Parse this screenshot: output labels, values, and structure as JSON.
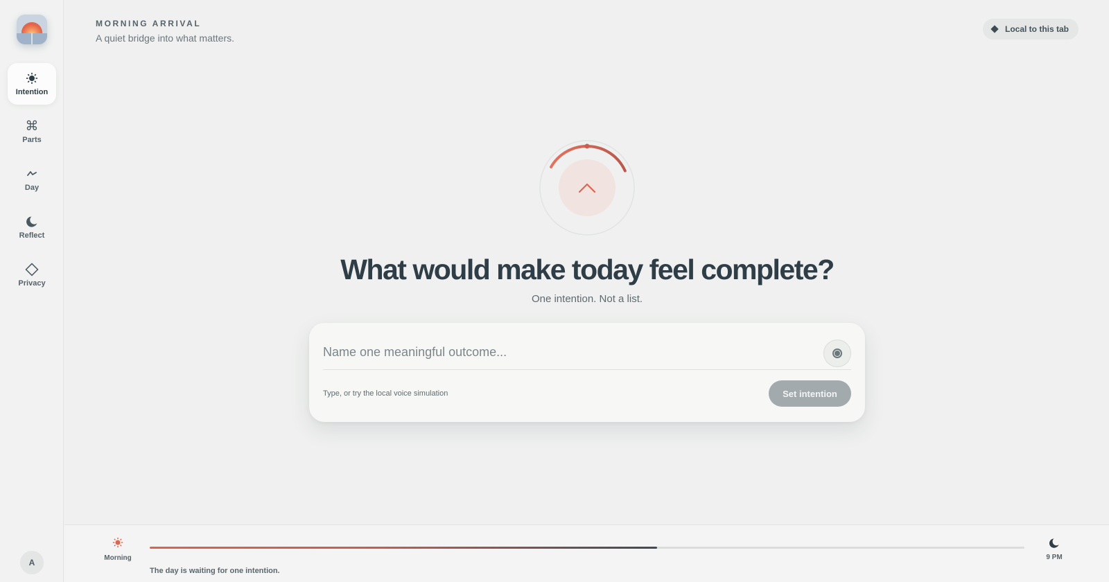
{
  "app": {
    "eyebrow": "MORNING ARRIVAL",
    "tagline": "A quiet bridge into what matters.",
    "privacy_badge": "Local to this tab"
  },
  "sidebar": {
    "items": [
      {
        "label": "Intention",
        "icon": "sun-icon",
        "active": true
      },
      {
        "label": "Parts",
        "icon": "command-icon",
        "active": false
      },
      {
        "label": "Day",
        "icon": "lightning-icon",
        "active": false
      },
      {
        "label": "Reflect",
        "icon": "moon-icon",
        "active": false
      },
      {
        "label": "Privacy",
        "icon": "diamond-icon",
        "active": false
      }
    ],
    "avatar_initial": "A"
  },
  "main": {
    "question": "What would make today feel complete?",
    "subtitle": "One intention. Not a list.",
    "dial_progress": 0.35,
    "input_placeholder": "Name one meaningful outcome...",
    "input_value": "",
    "hint": "Type, or try the local voice simulation",
    "submit_label": "Set intention"
  },
  "timeline": {
    "start_label": "Morning",
    "end_label": "9 PM",
    "progress": 0.58,
    "status": "The day is waiting for one intention."
  },
  "colors": {
    "accent": "#d9634f",
    "ink": "#2e3d46",
    "button_disabled": "#a2aaad"
  }
}
